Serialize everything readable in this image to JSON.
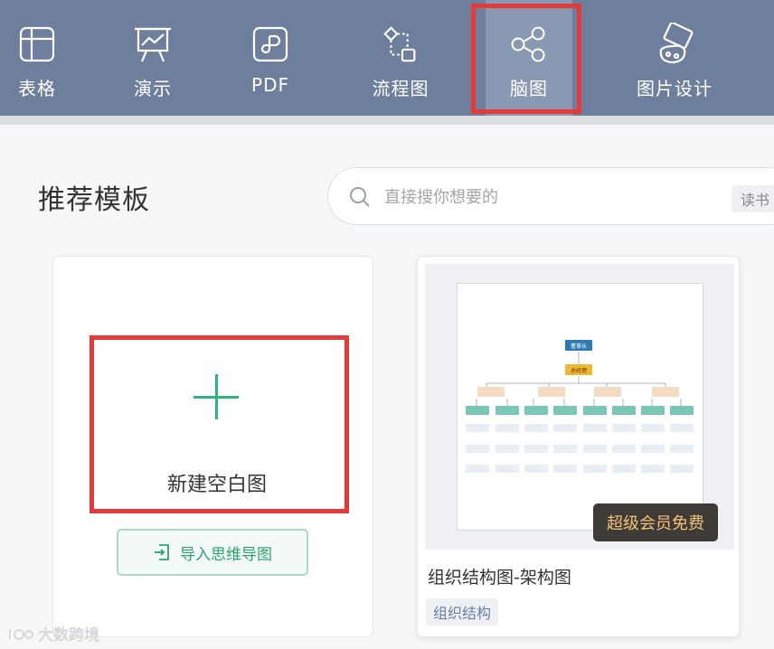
{
  "tabs": [
    {
      "id": "table",
      "label": "表格",
      "icon": "table-icon"
    },
    {
      "id": "slides",
      "label": "演示",
      "icon": "presentation-icon"
    },
    {
      "id": "pdf",
      "label": "PDF",
      "icon": "pdf-icon"
    },
    {
      "id": "flowchart",
      "label": "流程图",
      "icon": "flowchart-icon"
    },
    {
      "id": "mindmap",
      "label": "脑图",
      "icon": "mindmap-icon",
      "active": true
    },
    {
      "id": "imagedesign",
      "label": "图片设计",
      "icon": "image-design-icon"
    }
  ],
  "section_title": "推荐模板",
  "search": {
    "placeholder": "直接搜你想要的",
    "hot_tag": "读书"
  },
  "blank_card": {
    "label": "新建空白图",
    "import_label": "导入思维导图"
  },
  "template_card": {
    "title": "组织结构图-架构图",
    "tag": "组织结构",
    "badge": "超级会员免费",
    "preview": {
      "root": "董事长",
      "level2": "总经理"
    }
  },
  "watermark": "大数跨境",
  "colors": {
    "topbar": "#6e7f9e",
    "accent_green": "#2fb67c",
    "highlight_red": "#e53a3a",
    "badge_text": "#f3c27a"
  }
}
